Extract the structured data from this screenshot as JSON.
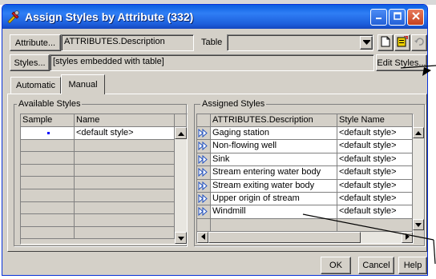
{
  "window": {
    "title": "Assign Styles by Attribute (332)"
  },
  "top": {
    "attribute_button": "Attribute...",
    "attribute_value": "ATTRIBUTES.Description",
    "table_label": "Table",
    "table_value": "",
    "styles_button": "Styles...",
    "styles_value": "[styles embedded with table]",
    "edit_styles_button": "Edit Styles..."
  },
  "tabs": [
    {
      "label": "Automatic"
    },
    {
      "label": "Manual"
    }
  ],
  "available": {
    "group_label": "Available Styles",
    "headers": {
      "sample": "Sample",
      "name": "Name"
    },
    "rows": [
      {
        "name": "<default style>"
      }
    ]
  },
  "assigned": {
    "group_label": "Assigned Styles",
    "headers": {
      "attribute": "ATTRIBUTES.Description",
      "style": "Style Name"
    },
    "rows": [
      {
        "attribute": "Gaging station",
        "style": "<default style>"
      },
      {
        "attribute": "Non-flowing well",
        "style": "<default style>"
      },
      {
        "attribute": "Sink",
        "style": "<default style>"
      },
      {
        "attribute": "Stream entering water body",
        "style": "<default style>"
      },
      {
        "attribute": "Stream exiting water body",
        "style": "<default style>"
      },
      {
        "attribute": "Upper origin of stream",
        "style": "<default style>"
      },
      {
        "attribute": "Windmill",
        "style": "<default style>"
      }
    ]
  },
  "footer": {
    "ok": "OK",
    "cancel": "Cancel",
    "help": "Help"
  },
  "colors": {
    "title_bar": "#1d5fdc",
    "dialog_bg": "#d4d0c8",
    "sample_dot": "#0000ff"
  }
}
